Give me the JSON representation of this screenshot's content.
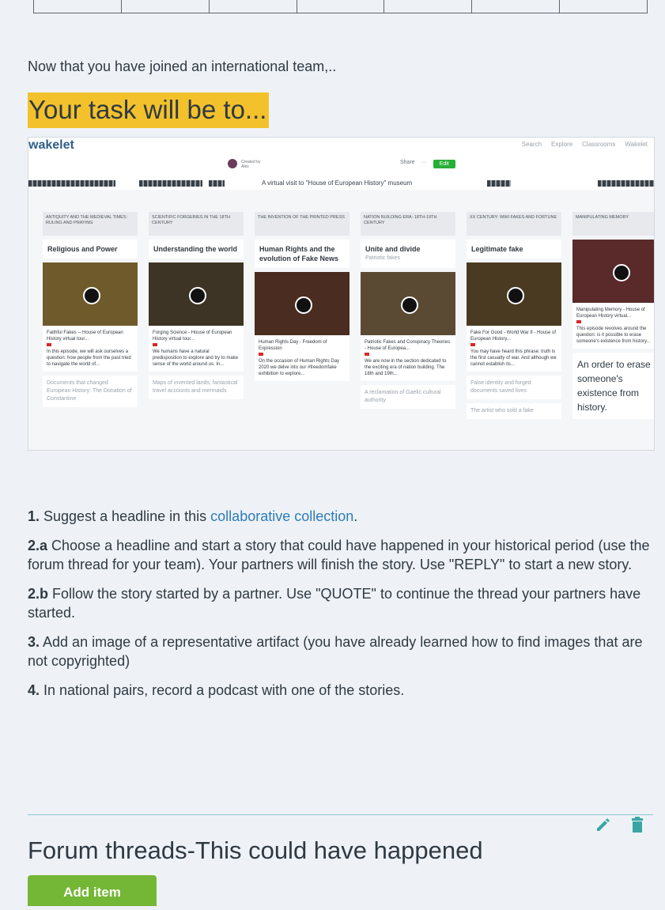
{
  "intro_text": "Now that you have joined an international team,..",
  "task_title": "Your task will be to...",
  "wakelet": {
    "logo": "wakelet",
    "nav": [
      "Search",
      "Explore",
      "Classrooms",
      "Wakelet"
    ],
    "creator_line1": "Created by",
    "creator_line2": "Alex",
    "actions": [
      "Share",
      "···",
      "Edit"
    ],
    "caption": "A virtual visit to \"House of European History\" museum",
    "columns": [
      {
        "head": "ANTIQUITY AND THE MEDIEVAL TIMES: Ruling and Praying",
        "card": "Religious and Power",
        "sub": "",
        "desc_title": "Faithful Fakes -- House of European History virtual tour...",
        "desc": "In this episode, we will ask ourselves a question: how people from the past tried to navigate the world of...",
        "note": "Documents that changed European History: The Donation of Constantine",
        "thumb": "#6f5a2b"
      },
      {
        "head": "SCIENTIFIC FORGERIES in the 18th century",
        "card": "Understanding the world",
        "sub": "",
        "desc_title": "Forging Science - House of European History virtual tour...",
        "desc": "We humans have a natural predisposition to explore and try to make sense of the world around us. In...",
        "note": "Maps of invented lands, fantastical travel accounts and mermaids",
        "thumb": "#3d3425"
      },
      {
        "head": "THE INVENTION OF THE PRINTED PRESS",
        "card": "Human Rights and the evolution of Fake News",
        "sub": "",
        "desc_title": "Human Rights Day - Freedom of Expression",
        "desc": "On the occasion of Human Rights Day 2020 we delve into our #freedomfake exhibition to explore...",
        "note": "",
        "thumb": "#4a2d20"
      },
      {
        "head": "NATION BUILDING ERA: 18th-19th century",
        "card": "Unite and divide",
        "sub": "Patriotic fakes",
        "desc_title": "Patriotic Fakes and Conspiracy Theories - House of Europea...",
        "desc": "We are now in the section dedicated to the exciting era of nation building. The 18th and 19th...",
        "note": "A reclamation of Gaelic cultural authority",
        "thumb": "#5b4a33"
      },
      {
        "head": "XX century: WWI Fakes and Fortune",
        "card": "Legitimate fake",
        "sub": "",
        "desc_title": "Fake For Good - World War II - House of European History...",
        "desc": "You may have heard this phrase: truth is the first casualty of war. And although we cannot establish its...",
        "note": "False identity and forged documents saved lives",
        "note2": "The artist who sold a fake",
        "thumb": "#4b3a22"
      },
      {
        "head": "Manipulating memory",
        "card": "",
        "sub": "",
        "desc_title": "Manipulating Memory - House of European History virtual...",
        "desc": "This episode revolves around the question: is it possible to erase someone's existence from history...",
        "note": "",
        "big_note": "An order to erase someone's existence from history.",
        "thumb": "#5a2a2a"
      }
    ]
  },
  "instructions": [
    {
      "num": "1.",
      "pre": " Suggest a headline in this ",
      "link": "collaborative collection",
      "post": "."
    },
    {
      "num": "2.a",
      "pre": " Choose a headline and start a story that could have happened in your historical period (use the forum thread for your team). Your partners will finish the story. Use \"REPLY\" to start a new story.",
      "link": "",
      "post": ""
    },
    {
      "num": "2.b",
      "pre": " Follow the story started by a partner. Use \"QUOTE\" to continue the thread your partners have started.",
      "link": "",
      "post": ""
    },
    {
      "num": "3.",
      "pre": " Add an image of a representative artifact (you have already learned how to find images that are not copyrighted)",
      "link": "",
      "post": ""
    },
    {
      "num": "4.",
      "pre": " In national pairs, record a podcast with one of the stories.",
      "link": "",
      "post": ""
    }
  ],
  "forum_title": "Forum threads-This could have happened",
  "add_item_label": "Add item",
  "colors": {
    "highlight": "#f3c12b",
    "link": "#2d7ab8",
    "button": "#74b635",
    "icon": "#3aa6a3"
  }
}
